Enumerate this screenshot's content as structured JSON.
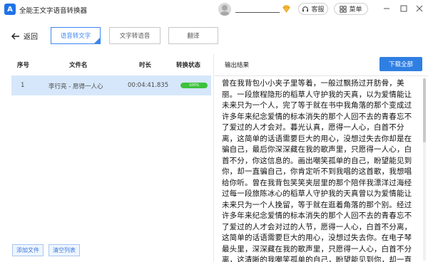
{
  "app": {
    "title": "全能王文字语音转换器",
    "logo_glyph": "A"
  },
  "titlebar": {
    "service_label": "客服",
    "menu_label": "菜单",
    "min_icon": "minimize-icon",
    "max_icon": "maximize-icon",
    "close_icon": "close-icon"
  },
  "toolbar": {
    "back_label": "返回",
    "tabs": [
      {
        "label": "语音转文字",
        "active": true
      },
      {
        "label": "文字转语音",
        "active": false
      },
      {
        "label": "翻译",
        "active": false
      }
    ]
  },
  "table": {
    "headers": {
      "index": "序号",
      "name": "文件名",
      "duration": "时长",
      "status": "转换状态"
    },
    "rows": [
      {
        "index": "1",
        "name": "李行亮 - 愿得一人心",
        "duration": "00:04:41.835",
        "progress": 100,
        "progress_text": "100%"
      }
    ]
  },
  "left_actions": {
    "add_label": "添加文件",
    "clear_label": "清空列表"
  },
  "output": {
    "title": "输出结果",
    "download_label": "下载全部",
    "text": "曾在我背包小小夹子里等着，一般过飘扬过开肪骨，美丽。一段旅程隐形的稻草人守护我的天真，以为爱情能让未来只为一个人，完了等于就在书中我角落的那个变成过许多年来纪念爱情的标本消失的那个人回不去的青春忘不了爱过的人才会对。暮光认真，愿得一人心，白首不分离，这简单的话语需要巨大的用心，没想过失去你却是在骗自己，最后你深深藏在我的歌声里，只愿得一人心，白首不分，你这信息的。画出嘲笑孤单的自己，盼望能见到你，却一直骗自己，你肯定听不到我唱的这首歌，我想唱给你听。曾在我背包笑笑夹层里的那个陪伴我漂洋过海经过每一段旅陈冰心的稻草人守护我的天真曾以为爱情能让未来只为一个人挽留，等于就在逛着角落的那个别。经过许多年来纪念爱情的标本消失的那个人回不去的青春忘不了爱过的人才会对过的人节，愿得一人心，白首不分离，这简单的话语需要巨大的用心，没想过失去你。在电子琴最头里，深深藏在我的歌声里，只愿得一人心，白首不分离，这清晰的我嘲笑孤单的自己，盼望能见到你，却一直骗自己，你谈你听不到我唱的这首歌曲，愿得一人心白。再说不分离，这简单的话语需要巨"
  },
  "colors": {
    "accent": "#2f7fe3",
    "selected_row": "#d6e7fb",
    "progress": "#3cc23c"
  }
}
